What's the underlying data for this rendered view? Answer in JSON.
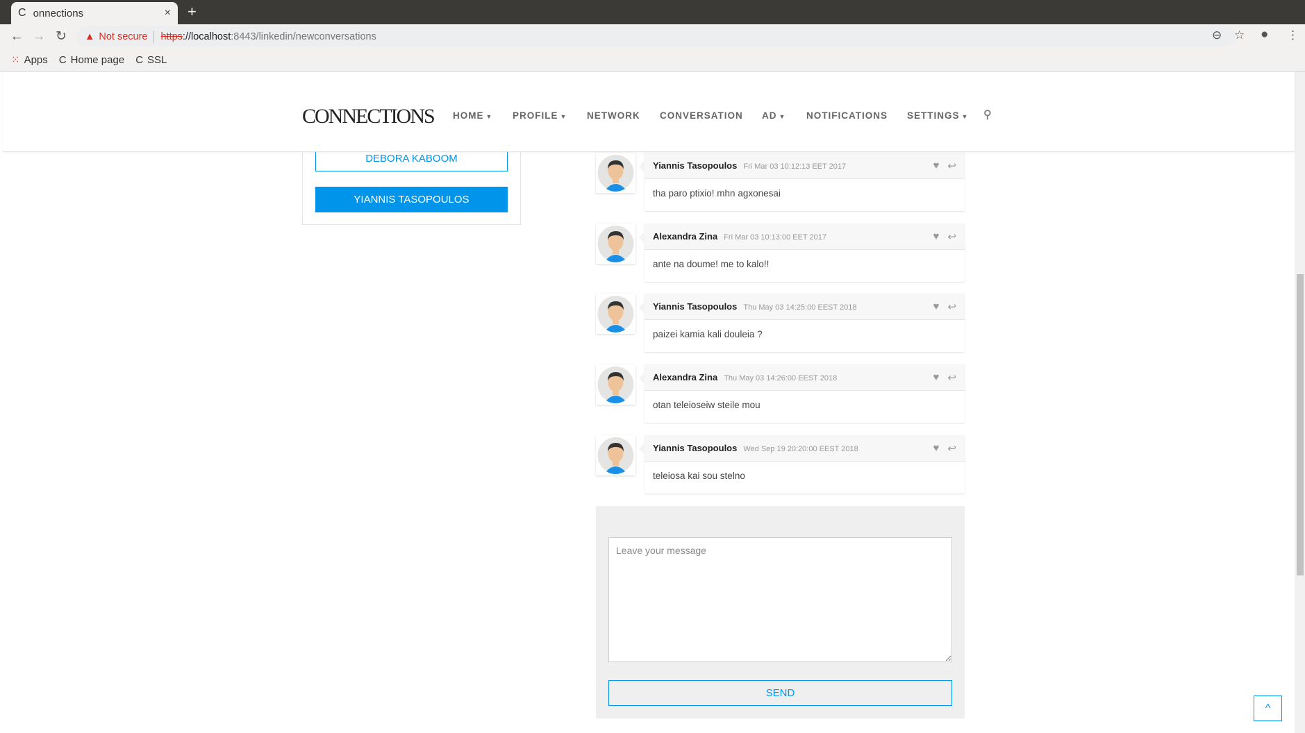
{
  "browser": {
    "tab_title": "onnections",
    "new_tab": "+",
    "close": "×",
    "not_secure": "Not secure",
    "url_scheme": "https",
    "url_host": "://localhost",
    "url_rest": ":8443/linkedin/newconversations",
    "bookmarks": [
      {
        "label": "Apps"
      },
      {
        "label": "Home page"
      },
      {
        "label": "SSL"
      }
    ]
  },
  "site": {
    "logo": "CONNECTIONS",
    "nav": [
      {
        "label": "HOME",
        "caret": true
      },
      {
        "label": "PROFILE",
        "caret": true
      },
      {
        "label": "NETWORK"
      },
      {
        "label": "CONVERSATION"
      },
      {
        "label": "AD",
        "caret": true
      },
      {
        "label": "NOTIFICATIONS"
      },
      {
        "label": "SETTINGS",
        "caret": true
      }
    ]
  },
  "contacts": [
    "DEBORA KABOOM",
    "YIANNIS TASOPOULOS"
  ],
  "messages": [
    {
      "name": "Yiannis Tasopoulos",
      "date": "Fri Mar 03 10:12:13 EET 2017",
      "text": "tha paro ptixio! mhn agxonesai"
    },
    {
      "name": "Alexandra Zina",
      "date": "Fri Mar 03 10:13:00 EET 2017",
      "text": "ante na doume! me to kalo!!"
    },
    {
      "name": "Yiannis Tasopoulos",
      "date": "Thu May 03 14:25:00 EEST 2018",
      "text": "paizei kamia kali douleia ?"
    },
    {
      "name": "Alexandra Zina",
      "date": "Thu May 03 14:26:00 EEST 2018",
      "text": "otan teleioseiw steile mou"
    },
    {
      "name": "Yiannis Tasopoulos",
      "date": "Wed Sep 19 20:20:00 EEST 2018",
      "text": "teleiosa kai sou stelno"
    }
  ],
  "form": {
    "placeholder": "Leave your message",
    "send": "SEND"
  },
  "back_to_top": "^",
  "colors": {
    "accent": "#0095eb"
  }
}
